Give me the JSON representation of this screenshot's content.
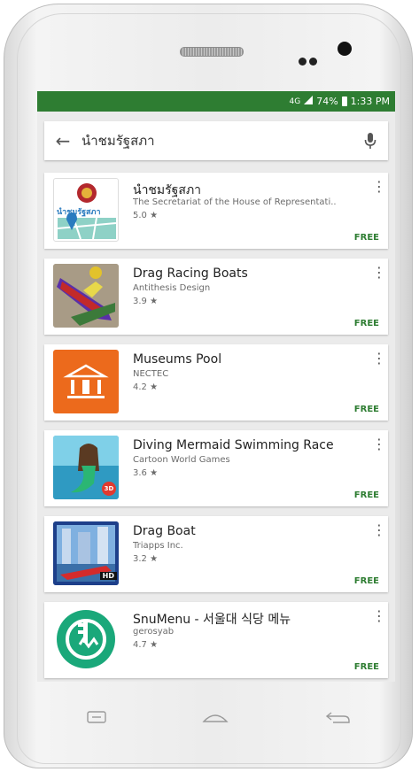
{
  "status_bar": {
    "network": "4G",
    "battery": "74%",
    "time": "1:33 PM"
  },
  "search": {
    "query": "นำชมรัฐสภา"
  },
  "apps": [
    {
      "title": "นำชมรัฐสภา",
      "developer": "The Secretariat of the House of Representati..",
      "rating": "5.0",
      "price": "FREE",
      "icon": "parliament-map-icon",
      "icon_text": "นำชมรัฐสภา"
    },
    {
      "title": "Drag Racing Boats",
      "developer": "Antithesis Design",
      "rating": "3.9",
      "price": "FREE",
      "icon": "racing-boat-icon"
    },
    {
      "title": "Museums Pool",
      "developer": "NECTEC",
      "rating": "4.2",
      "price": "FREE",
      "icon": "museum-icon"
    },
    {
      "title": "Diving Mermaid Swimming Race",
      "developer": "Cartoon World Games",
      "rating": "3.6",
      "price": "FREE",
      "icon": "mermaid-icon",
      "icon_badge": "3D"
    },
    {
      "title": "Drag Boat",
      "developer": "Triapps Inc.",
      "rating": "3.2",
      "price": "FREE",
      "icon": "speedboat-icon",
      "icon_badge": "HD"
    },
    {
      "title": "SnuMenu - 서울대 식당 메뉴",
      "developer": "gerosyab",
      "rating": "4.7",
      "price": "FREE",
      "icon": "snumenu-icon"
    }
  ],
  "colors": {
    "status_bar": "#2e7d32",
    "price": "#2e7d32",
    "museum_orange": "#ec6a1c",
    "snumenu_green": "#1aa87a"
  }
}
